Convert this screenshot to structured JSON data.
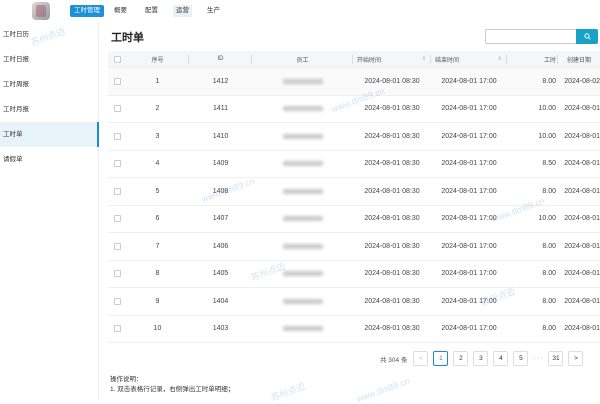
{
  "header": {
    "nav": [
      {
        "label": "工时管理",
        "type": "brand"
      },
      {
        "label": "概要",
        "type": "normal"
      },
      {
        "label": "配置",
        "type": "normal"
      },
      {
        "label": "运营",
        "type": "active"
      },
      {
        "label": "生产",
        "type": "normal"
      }
    ]
  },
  "sidebar": {
    "items": [
      {
        "label": "工时日历",
        "active": false
      },
      {
        "label": "工时日报",
        "active": false
      },
      {
        "label": "工时周报",
        "active": false
      },
      {
        "label": "工时月报",
        "active": false
      },
      {
        "label": "工时单",
        "active": true
      },
      {
        "label": "请假单",
        "active": false
      }
    ]
  },
  "main": {
    "title": "工时单",
    "search": {
      "placeholder": "",
      "icon": "search-icon"
    }
  },
  "table": {
    "columns": [
      "序号",
      "ID",
      "员工",
      "开始时间",
      "结束时间",
      "工时",
      "创建日期"
    ],
    "rows": [
      {
        "seq": "1",
        "id": "1412",
        "start": "2024-08-01 08:30",
        "end": "2024-08-01 17:00",
        "hours": "8.00",
        "created": "2024-08-02"
      },
      {
        "seq": "2",
        "id": "1411",
        "start": "2024-08-01 08:30",
        "end": "2024-08-01 17:00",
        "hours": "10.00",
        "created": "2024-08-01"
      },
      {
        "seq": "3",
        "id": "1410",
        "start": "2024-08-01 08:30",
        "end": "2024-08-01 17:00",
        "hours": "10.00",
        "created": "2024-08-01"
      },
      {
        "seq": "4",
        "id": "1409",
        "start": "2024-08-01 08:30",
        "end": "2024-08-01 17:00",
        "hours": "8.50",
        "created": "2024-08-01"
      },
      {
        "seq": "5",
        "id": "1408",
        "start": "2024-08-01 08:30",
        "end": "2024-08-01 17:00",
        "hours": "8.00",
        "created": "2024-08-01"
      },
      {
        "seq": "6",
        "id": "1407",
        "start": "2024-08-01 08:30",
        "end": "2024-08-01 17:00",
        "hours": "10.00",
        "created": "2024-08-01"
      },
      {
        "seq": "7",
        "id": "1406",
        "start": "2024-08-01 08:30",
        "end": "2024-08-01 17:00",
        "hours": "8.00",
        "created": "2024-08-01"
      },
      {
        "seq": "8",
        "id": "1405",
        "start": "2024-08-01 08:30",
        "end": "2024-08-01 17:00",
        "hours": "8.00",
        "created": "2024-08-01"
      },
      {
        "seq": "9",
        "id": "1404",
        "start": "2024-08-01 08:30",
        "end": "2024-08-01 17:00",
        "hours": "8.00",
        "created": "2024-08-01"
      },
      {
        "seq": "10",
        "id": "1403",
        "start": "2024-08-01 08:30",
        "end": "2024-08-01 17:00",
        "hours": "8.00",
        "created": "2024-08-01"
      }
    ]
  },
  "pagination": {
    "total_text": "共 304 条",
    "prev": "<",
    "next": ">",
    "pages": [
      "1",
      "2",
      "3",
      "4",
      "5"
    ],
    "ellipsis": "···",
    "last": "31",
    "current": "1"
  },
  "notes": {
    "title": "操作说明：",
    "line1": "1. 双击表格行记录，右侧弹出工时单明细；"
  },
  "watermark": {
    "text1": "苏州点迈",
    "text2": "www.dm89.cn"
  },
  "colors": {
    "accent": "#1a8ccf",
    "brand": "#1f8fd8",
    "search_button": "#18a3c4"
  }
}
